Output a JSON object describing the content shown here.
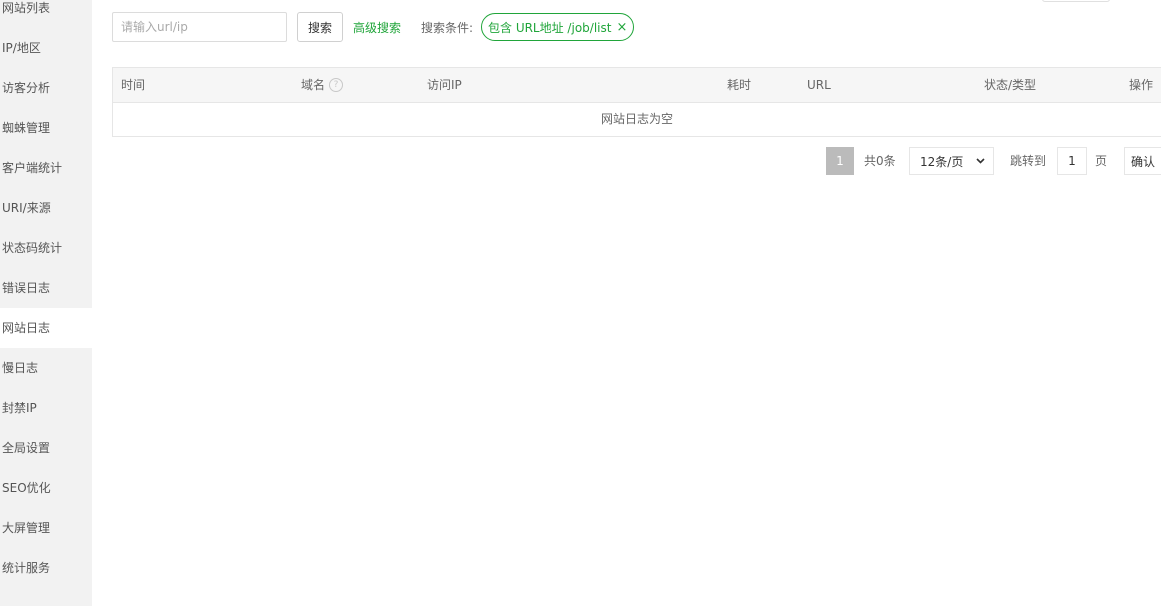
{
  "sidebar": {
    "items": [
      {
        "label": "网站列表"
      },
      {
        "label": "IP/地区"
      },
      {
        "label": "访客分析"
      },
      {
        "label": "蜘蛛管理"
      },
      {
        "label": "客户端统计"
      },
      {
        "label": "URI/来源"
      },
      {
        "label": "状态码统计"
      },
      {
        "label": "错误日志"
      },
      {
        "label": "网站日志",
        "active": true
      },
      {
        "label": "慢日志"
      },
      {
        "label": "封禁IP"
      },
      {
        "label": "全局设置"
      },
      {
        "label": "SEO优化"
      },
      {
        "label": "大屏管理"
      },
      {
        "label": "统计服务"
      }
    ]
  },
  "toolbar": {
    "search_placeholder": "请输入url/ip",
    "search_value": "",
    "search_label": "搜索",
    "advanced_label": "高级搜索",
    "condition_label": "搜索条件:",
    "condition_tag": "包含 URL地址 /job/list",
    "condition_close": "×"
  },
  "table": {
    "columns": [
      "时间",
      "域名",
      "访问IP",
      "耗时",
      "URL",
      "状态/类型",
      "操作"
    ],
    "help_icon": "?",
    "empty_text": "网站日志为空"
  },
  "pagination": {
    "current_page": "1",
    "total_text": "共0条",
    "page_size": "12条/页",
    "page_size_icon": "chevron-down",
    "goto_label": "跳转到",
    "goto_value": "1",
    "page_unit": "页",
    "confirm_label": "确认"
  },
  "colors": {
    "accent": "#20a53a",
    "sidebar_bg": "#f2f2f2",
    "table_header_bg": "#f6f6f6",
    "page_current_bg": "#bbbbbb"
  }
}
